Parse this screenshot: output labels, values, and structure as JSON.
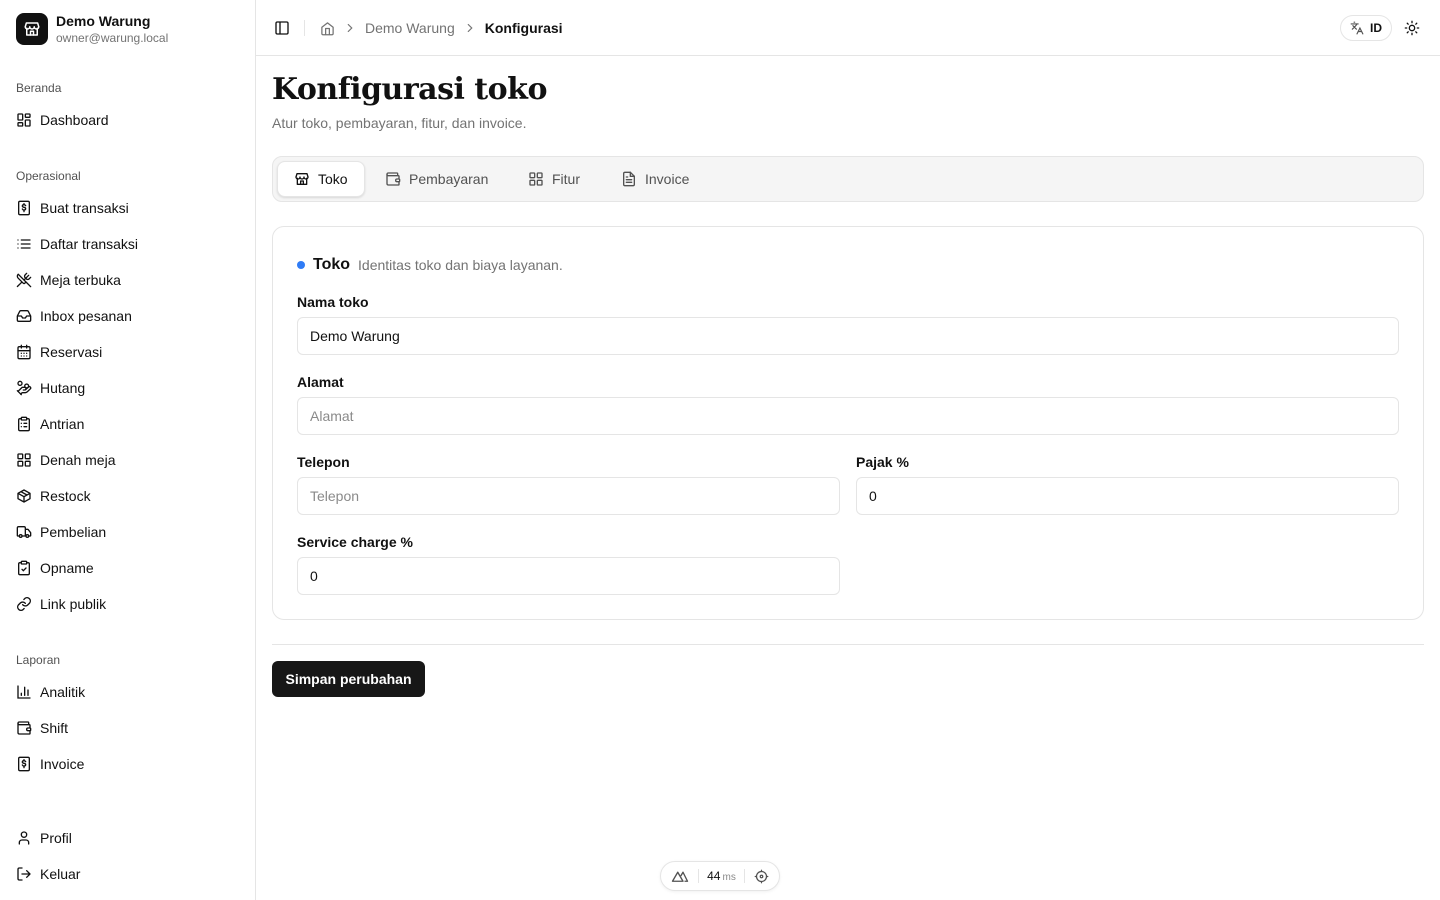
{
  "brand": {
    "name": "Demo Warung",
    "email": "owner@warung.local"
  },
  "sidebar": {
    "groups": [
      {
        "label": "Beranda",
        "items": [
          {
            "label": "Dashboard",
            "icon": "dashboard-icon"
          }
        ]
      },
      {
        "label": "Operasional",
        "items": [
          {
            "label": "Buat transaksi",
            "icon": "receipt-icon"
          },
          {
            "label": "Daftar transaksi",
            "icon": "list-icon"
          },
          {
            "label": "Meja terbuka",
            "icon": "utensils-crossed-icon"
          },
          {
            "label": "Inbox pesanan",
            "icon": "inbox-icon"
          },
          {
            "label": "Reservasi",
            "icon": "calendar-icon"
          },
          {
            "label": "Hutang",
            "icon": "handcoins-icon"
          },
          {
            "label": "Antrian",
            "icon": "clipboard-list-icon"
          },
          {
            "label": "Denah meja",
            "icon": "grid-icon"
          },
          {
            "label": "Restock",
            "icon": "package-icon"
          },
          {
            "label": "Pembelian",
            "icon": "truck-icon"
          },
          {
            "label": "Opname",
            "icon": "clipboard-check-icon"
          },
          {
            "label": "Link publik",
            "icon": "link-icon"
          }
        ]
      },
      {
        "label": "Laporan",
        "items": [
          {
            "label": "Analitik",
            "icon": "bar-chart-icon"
          },
          {
            "label": "Shift",
            "icon": "wallet-icon"
          },
          {
            "label": "Invoice",
            "icon": "invoice-icon"
          }
        ]
      }
    ],
    "footer": [
      {
        "label": "Profil",
        "icon": "user-icon"
      },
      {
        "label": "Keluar",
        "icon": "logout-icon"
      }
    ]
  },
  "header": {
    "breadcrumb": {
      "parent": "Demo Warung",
      "current": "Konfigurasi"
    },
    "lang": "ID"
  },
  "main": {
    "title": "Konfigurasi toko",
    "subtitle": "Atur toko, pembayaran, fitur, dan invoice.",
    "tabs": [
      {
        "label": "Toko",
        "icon": "store-icon",
        "active": true
      },
      {
        "label": "Pembayaran",
        "icon": "wallet-icon",
        "active": false
      },
      {
        "label": "Fitur",
        "icon": "grid-icon",
        "active": false
      },
      {
        "label": "Invoice",
        "icon": "document-icon",
        "active": false
      }
    ],
    "card": {
      "title": "Toko",
      "description": "Identitas toko dan biaya layanan.",
      "accent": "#2f7cf6",
      "fields": {
        "nama": {
          "label": "Nama toko",
          "value": "Demo Warung",
          "placeholder": ""
        },
        "alamat": {
          "label": "Alamat",
          "value": "",
          "placeholder": "Alamat"
        },
        "telepon": {
          "label": "Telepon",
          "value": "",
          "placeholder": "Telepon"
        },
        "pajak": {
          "label": "Pajak %",
          "value": "0",
          "placeholder": ""
        },
        "service": {
          "label": "Service charge %",
          "value": "0",
          "placeholder": ""
        }
      }
    },
    "save_label": "Simpan perubahan"
  },
  "devtools": {
    "time": "44",
    "unit": "ms"
  }
}
